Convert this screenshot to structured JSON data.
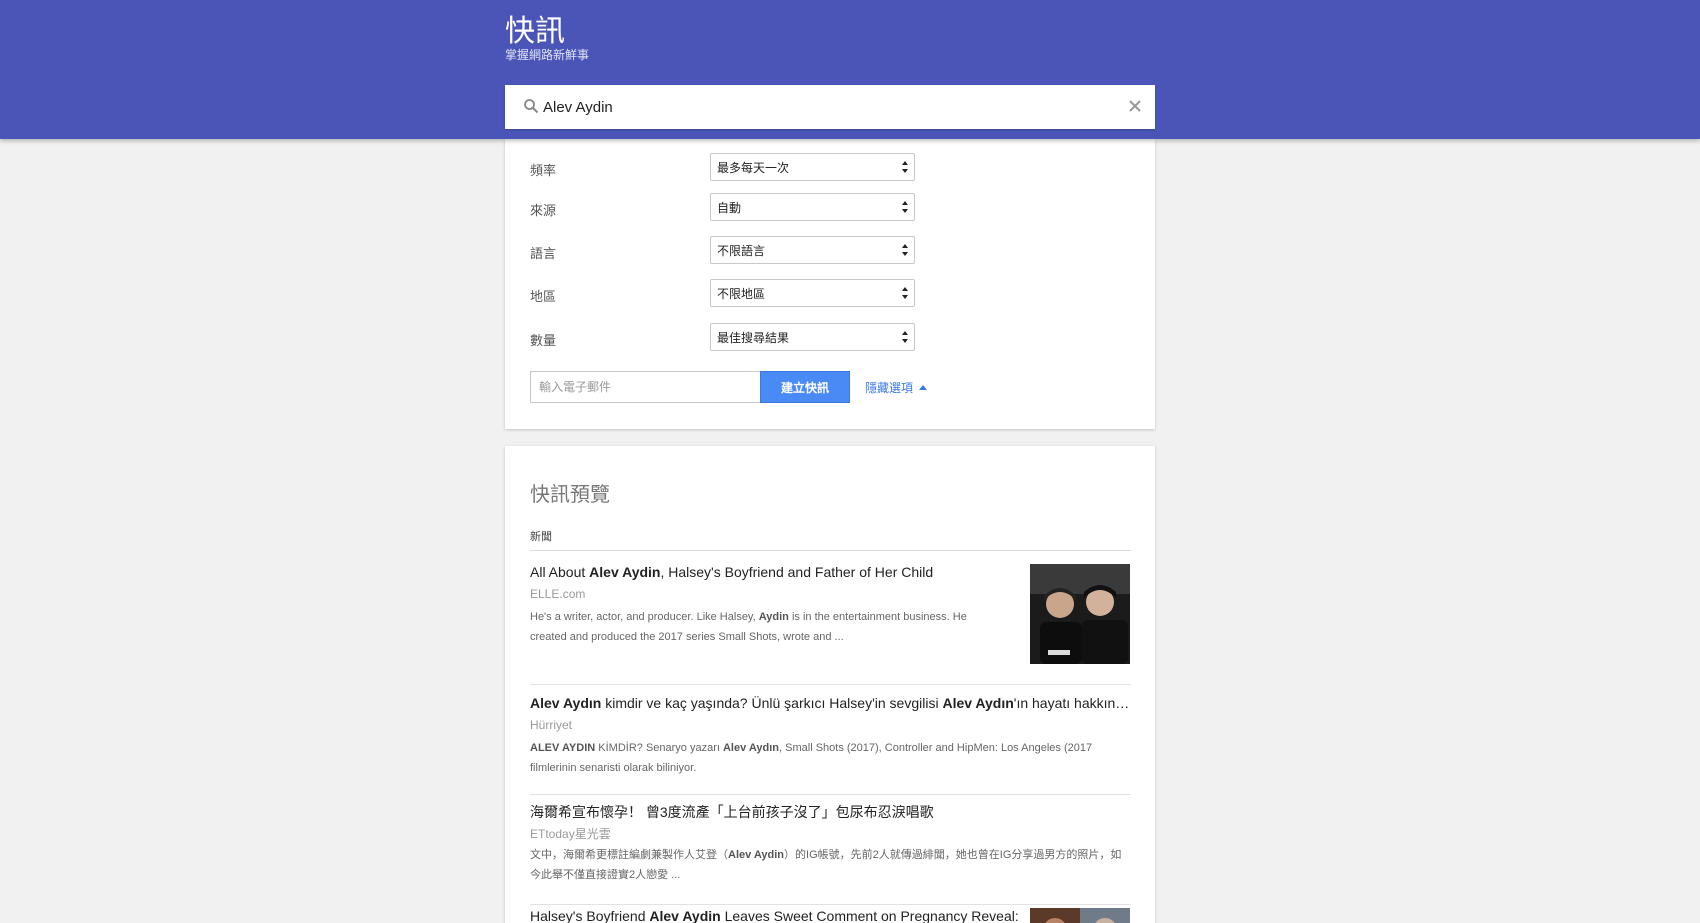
{
  "header": {
    "title": "快訊",
    "subtitle": "掌握網路新鮮事"
  },
  "search": {
    "value": "Alev Aydin",
    "clear_symbol": "✕"
  },
  "options": {
    "rows": [
      {
        "label": "頻率",
        "value": "最多每天一次"
      },
      {
        "label": "來源",
        "value": "自動"
      },
      {
        "label": "語言",
        "value": "不限語言"
      },
      {
        "label": "地區",
        "value": "不限地區"
      },
      {
        "label": "數量",
        "value": "最佳搜尋結果"
      }
    ],
    "email_placeholder": "輸入電子郵件",
    "create_label": "建立快訊",
    "hide_label": "隱藏選項"
  },
  "preview": {
    "title": "快訊預覽",
    "section": "新聞",
    "results": [
      {
        "title_parts": [
          {
            "t": "All About ",
            "b": false
          },
          {
            "t": "Alev Aydin",
            "b": true
          },
          {
            "t": ", Halsey's Boyfriend and Father of Her Child",
            "b": false
          }
        ],
        "source": "ELLE.com",
        "snippet_parts": [
          {
            "t": "He's a writer, actor, and producer. Like Halsey, ",
            "b": false
          },
          {
            "t": "Aydin",
            "b": true
          },
          {
            "t": " is in the entertainment business. He created and produced the 2017 series Small Shots, wrote and ...",
            "b": false
          }
        ],
        "has_thumb": true
      },
      {
        "title_parts": [
          {
            "t": "Alev Aydın",
            "b": true
          },
          {
            "t": " kimdir ve kaç yaşında? Ünlü şarkıcı Halsey'in sevgilisi ",
            "b": false
          },
          {
            "t": "Alev Aydın",
            "b": true
          },
          {
            "t": "'ın hayatı hakkında ...",
            "b": false
          }
        ],
        "source": "Hürriyet",
        "snippet_parts": [
          {
            "t": "ALEV AYDIN",
            "b": true
          },
          {
            "t": " KİMDİR? Senaryo yazarı ",
            "b": false
          },
          {
            "t": "Alev Aydın",
            "b": true
          },
          {
            "t": ", Small Shots (2017), Controller and HipMen: Los Angeles (2017 filmlerinin senaristi olarak biliniyor.",
            "b": false
          }
        ],
        "has_thumb": false
      },
      {
        "title_parts": [
          {
            "t": "海爾希宣布懷孕！ 曾3度流產「上台前孩子沒了」包尿布忍淚唱歌",
            "b": false
          }
        ],
        "source": "ETtoday星光雲",
        "snippet_parts": [
          {
            "t": "文中，海爾希更標註編劇兼製作人艾登（",
            "b": false
          },
          {
            "t": "Alev Aydin",
            "b": true
          },
          {
            "t": "）的IG帳號，先前2人就傳過緋聞，她也曾在IG分享過男方的照片，如今此舉不僅直接證實2人戀愛 ...",
            "b": false
          }
        ],
        "has_thumb": false
      },
      {
        "title_parts": [
          {
            "t": "Halsey's Boyfriend ",
            "b": false
          },
          {
            "t": "Alev Aydin",
            "b": true
          },
          {
            "t": " Leaves Sweet Comment on Pregnancy Reveal:",
            "b": false
          }
        ],
        "source": "",
        "snippet_parts": [],
        "has_thumb": true
      }
    ]
  }
}
